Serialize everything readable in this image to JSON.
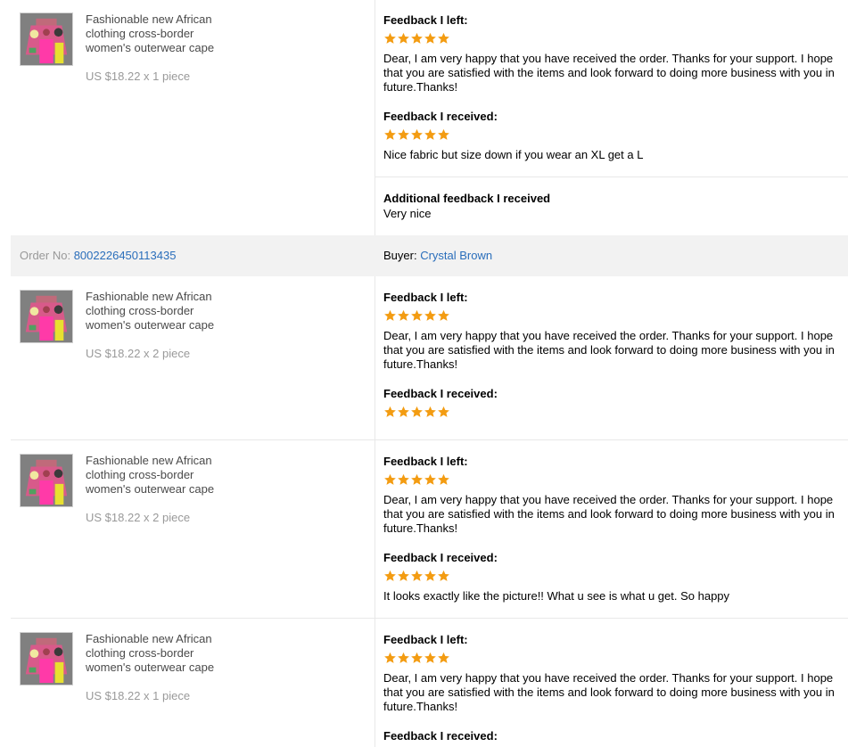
{
  "product": {
    "title": "Fashionable new African clothing cross-border women's outerwear cape"
  },
  "labels": {
    "feedback_left": "Feedback I left:",
    "feedback_received": "Feedback I received:",
    "additional_feedback": "Additional feedback I received",
    "order_no": "Order No:",
    "buyer": "Buyer:"
  },
  "seller_message": "Dear, I am very happy that you have received the order. Thanks for your support. I hope that you are satisfied with the items and look forward to doing more business with you in future.Thanks!",
  "colors": {
    "star": "#f39c12",
    "link": "#2a6ebb",
    "bar": "#f2f2f2"
  },
  "rows": [
    {
      "price": "US $18.22 x 1 piece",
      "left_rating": 5,
      "received_rating": 5,
      "received_text": "Nice fabric but size down if you wear an XL get a L",
      "additional_text": "Very nice"
    },
    {
      "price": "US $18.22 x 2 piece",
      "left_rating": 5,
      "received_rating": 5,
      "received_text": ""
    },
    {
      "price": "US $18.22 x 2 piece",
      "left_rating": 5,
      "received_rating": 5,
      "received_text": "It looks exactly like the picture!! What u see is what u get. So happy"
    },
    {
      "price": "US $18.22 x 1 piece",
      "left_rating": 5
    }
  ],
  "order": {
    "number": "8002226450113435",
    "buyer_name": "Crystal Brown"
  }
}
